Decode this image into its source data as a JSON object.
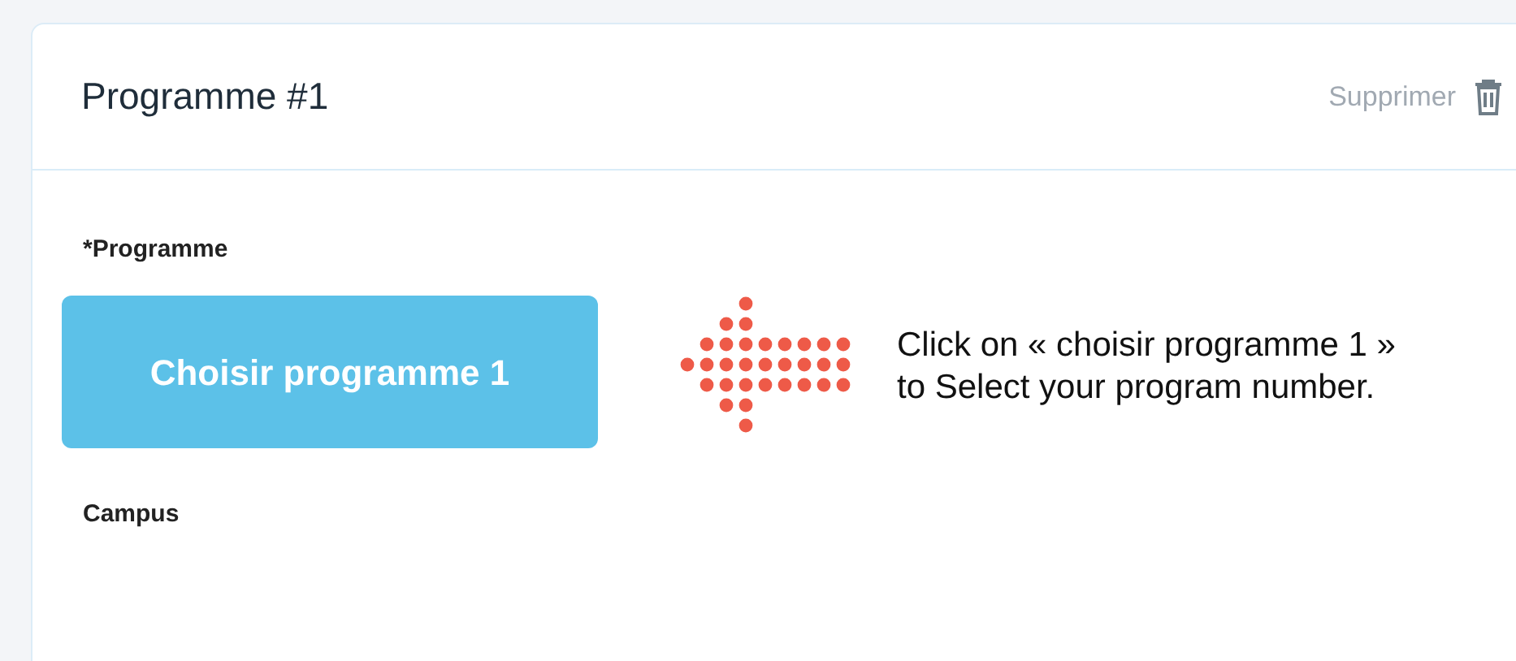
{
  "card": {
    "title": "Programme #1",
    "delete_label": "Supprimer"
  },
  "fields": [
    {
      "kind": "button",
      "label": "*Programme",
      "button": "Choisir programme 1"
    },
    {
      "kind": "empty",
      "label": "Campus"
    }
  ],
  "instruction_lines": [
    "Click on « choisir programme 1 »",
    "to Select your program number."
  ]
}
